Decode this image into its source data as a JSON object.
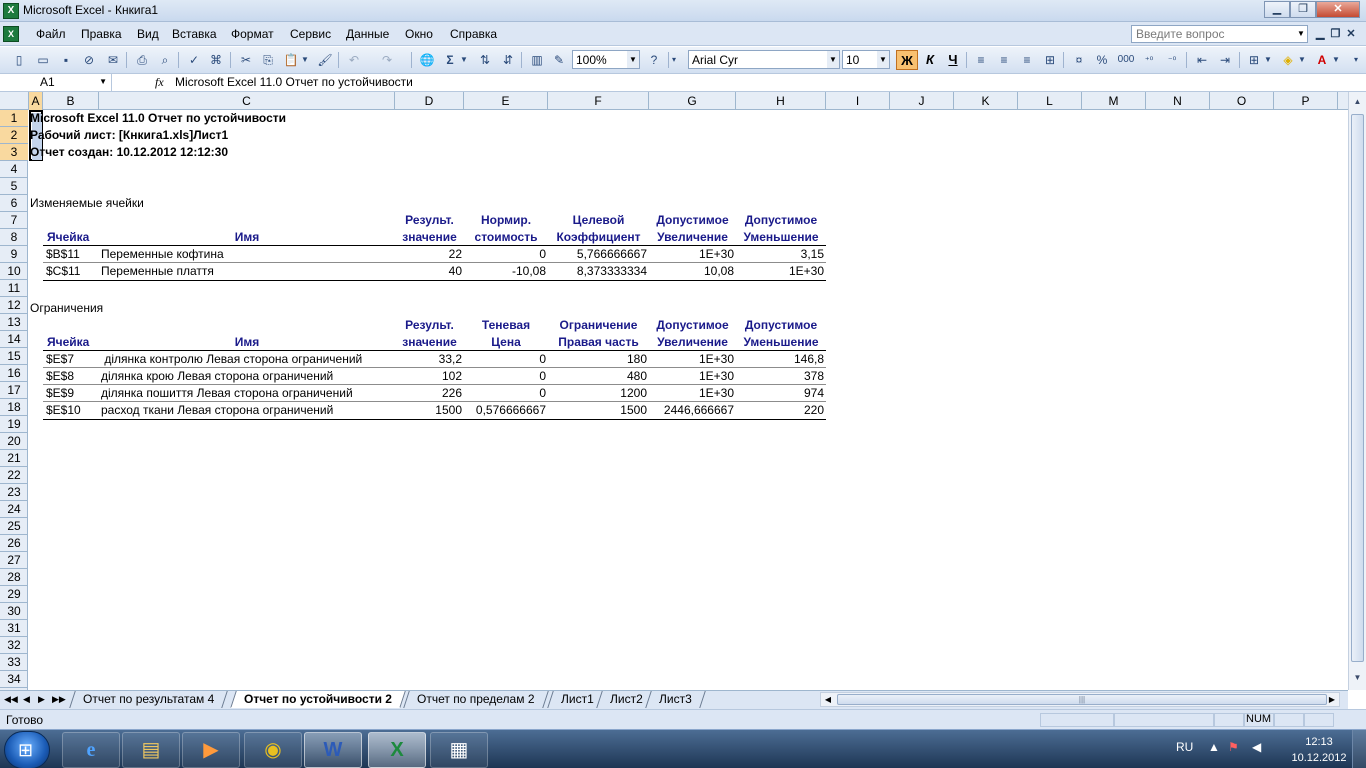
{
  "window": {
    "title": "Microsoft Excel - Кнкига1",
    "minimize": "▁",
    "restore": "❐",
    "close": "✕"
  },
  "menu": {
    "items": [
      "Файл",
      "Правка",
      "Вид",
      "Вставка",
      "Формат",
      "Сервис",
      "Данные",
      "Окно",
      "Справка"
    ],
    "help_placeholder": "Введите вопрос"
  },
  "toolbar": {
    "zoom": "100%",
    "font_name": "Arial Cyr",
    "font_size": "10",
    "bold": "Ж",
    "italic": "К",
    "underline": "Ч",
    "percent": "%",
    "thousands": "000"
  },
  "formula_bar": {
    "cell_ref": "A1",
    "fx": "fx",
    "content": "Microsoft Excel 11.0 Отчет по устойчивости"
  },
  "columns": [
    "A",
    "B",
    "C",
    "D",
    "E",
    "F",
    "G",
    "H",
    "I",
    "J",
    "K",
    "L",
    "M",
    "N",
    "O",
    "P"
  ],
  "rows": [
    "1",
    "2",
    "3",
    "4",
    "5",
    "6",
    "7",
    "8",
    "9",
    "10",
    "11",
    "12",
    "13",
    "14",
    "15",
    "16",
    "17",
    "18",
    "19",
    "20",
    "21",
    "22",
    "23",
    "24",
    "25",
    "26",
    "27",
    "28",
    "29",
    "30",
    "31",
    "32",
    "33",
    "34"
  ],
  "report": {
    "line1": "Microsoft Excel 11.0 Отчет по устойчивости",
    "line2": "Рабочий лист: [Кнкига1.xls]Лист1",
    "line3": "Отчет создан: 10.12.2012 12:12:30",
    "section1_title": "Изменяемые ячейки",
    "section1_headers_top": [
      "",
      "",
      "Результ.",
      "Нормир.",
      "Целевой",
      "Допустимое",
      "Допустимое"
    ],
    "section1_headers_bottom": [
      "Ячейка",
      "Имя",
      "значение",
      "стоимость",
      "Коэффициент",
      "Увеличение",
      "Уменьшение"
    ],
    "section1_rows": [
      [
        "$B$11",
        "Переменные кофтина",
        "22",
        "0",
        "5,766666667",
        "1E+30",
        "3,15"
      ],
      [
        "$C$11",
        "Переменные плаття",
        "40",
        "-10,08",
        "8,373333334",
        "10,08",
        "1E+30"
      ]
    ],
    "section2_title": "Ограничения",
    "section2_headers_top": [
      "",
      "",
      "Результ.",
      "Теневая",
      "Ограничение",
      "Допустимое",
      "Допустимое"
    ],
    "section2_headers_bottom": [
      "Ячейка",
      "Имя",
      "значение",
      "Цена",
      "Правая часть",
      "Увеличение",
      "Уменьшение"
    ],
    "section2_rows": [
      [
        "$E$7",
        " ділянка контролю Левая сторона ограничений",
        "33,2",
        "0",
        "180",
        "1E+30",
        "146,8"
      ],
      [
        "$E$8",
        "ділянка крою Левая сторона ограничений",
        "102",
        "0",
        "480",
        "1E+30",
        "378"
      ],
      [
        "$E$9",
        "ділянка пошиття Левая сторона ограничений",
        "226",
        "0",
        "1200",
        "1E+30",
        "974"
      ],
      [
        "$E$10",
        "расход ткани Левая сторона ограничений",
        "1500",
        "0,576666667",
        "1500",
        "2446,666667",
        "220"
      ]
    ]
  },
  "sheets": {
    "nav": [
      "◀◀",
      "◀",
      "▶",
      "▶▶"
    ],
    "tabs": [
      "Отчет по результатам 4",
      "Отчет по устойчивости 2",
      "Отчет по пределам 2",
      "Лист1",
      "Лист2",
      "Лист3"
    ],
    "active_index": 1
  },
  "status": {
    "text": "Готово",
    "num": "NUM"
  },
  "taskbar": {
    "lang": "RU",
    "time": "12:13",
    "date": "10.12.2012"
  }
}
